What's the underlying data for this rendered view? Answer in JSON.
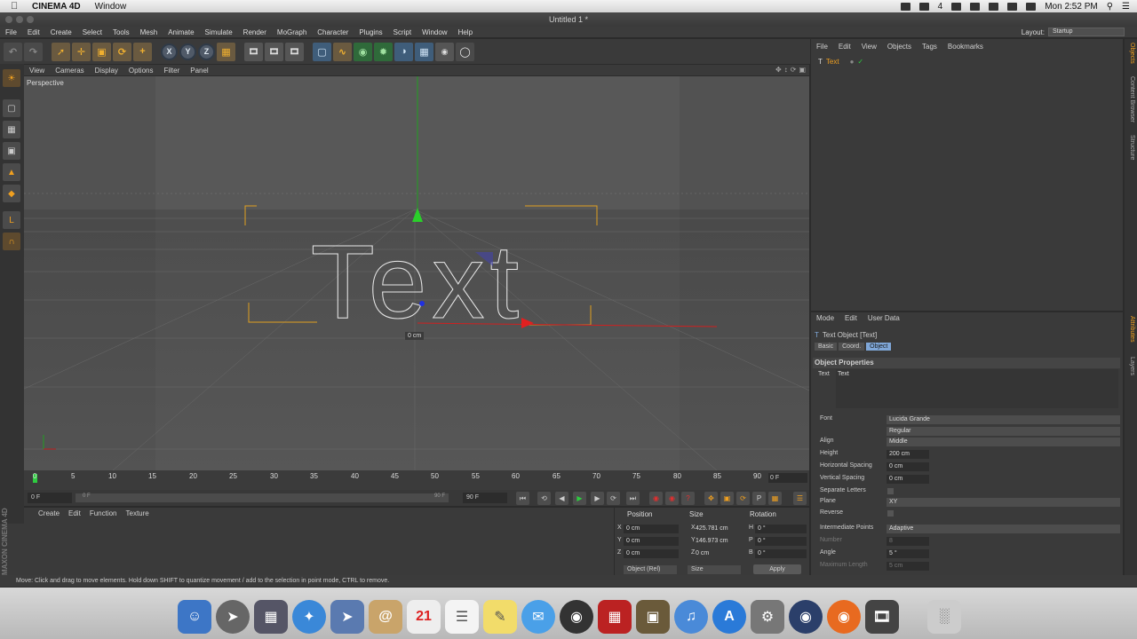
{
  "macbar": {
    "app_name": "CINEMA 4D",
    "menu": [
      "Window"
    ],
    "right_status": "4",
    "clock": "Mon 2:52 PM"
  },
  "window": {
    "title": "Untitled 1 *"
  },
  "app_menu": {
    "items": [
      "File",
      "Edit",
      "Create",
      "Select",
      "Tools",
      "Mesh",
      "Animate",
      "Simulate",
      "Render",
      "MoGraph",
      "Character",
      "Plugins",
      "Script",
      "Window",
      "Help"
    ],
    "layout_label": "Layout:",
    "layout_value": "Startup"
  },
  "viewport_menu": {
    "items": [
      "View",
      "Cameras",
      "Display",
      "Options",
      "Filter",
      "Panel"
    ]
  },
  "viewport": {
    "label": "Perspective",
    "readout": "0 cm",
    "text_object": "Text",
    "colors": {
      "bg": "#525252",
      "outline": "#e8e8e8",
      "x_axis": "#e02020",
      "y_axis": "#20d020",
      "z_axis": "#3030e0",
      "bbox": "#e0a020"
    }
  },
  "timeline": {
    "ticks": [
      "0",
      "5",
      "10",
      "15",
      "20",
      "25",
      "30",
      "35",
      "40",
      "45",
      "50",
      "55",
      "60",
      "65",
      "70",
      "75",
      "80",
      "85",
      "90"
    ],
    "frame_display": "0 F",
    "start_field": "0 F",
    "preview_start": "0 F",
    "preview_end": "90 F",
    "end_field": "90 F"
  },
  "material_menu": {
    "items": [
      "Create",
      "Edit",
      "Function",
      "Texture"
    ]
  },
  "brand_vertical": "MAXON CINEMA 4D",
  "coords": {
    "headers": {
      "position": "Position",
      "size": "Size",
      "rotation": "Rotation"
    },
    "rows": [
      {
        "axis": "X",
        "pos": "0 cm",
        "size_axis": "X",
        "size": "425.781 cm",
        "rot_axis": "H",
        "rot": "0 °"
      },
      {
        "axis": "Y",
        "pos": "0 cm",
        "size_axis": "Y",
        "size": "146.973 cm",
        "rot_axis": "P",
        "rot": "0 °"
      },
      {
        "axis": "Z",
        "pos": "0 cm",
        "size_axis": "Z",
        "size": "0 cm",
        "rot_axis": "B",
        "rot": "0 °"
      }
    ],
    "mode_dropdown": "Object (Rel)",
    "size_dropdown": "Size",
    "apply_label": "Apply"
  },
  "status_text": "Move: Click and drag to move elements. Hold down SHIFT to quantize movement / add to the selection in point mode, CTRL to remove.",
  "object_manager": {
    "menu": [
      "File",
      "Edit",
      "View",
      "Objects",
      "Tags",
      "Bookmarks"
    ],
    "objects": [
      {
        "name": "Text"
      }
    ]
  },
  "attributes": {
    "menu": [
      "Mode",
      "Edit",
      "User Data"
    ],
    "title": "Text Object [Text]",
    "tabs": [
      "Basic",
      "Coord.",
      "Object"
    ],
    "active_tab": "Object",
    "section": "Object Properties",
    "text_label": "Text",
    "text_value": "Text",
    "font_label": "Font",
    "font_value": "Lucida Grande",
    "font_style": "Regular",
    "align_label": "Align",
    "align_value": "Middle",
    "height_label": "Height",
    "height_value": "200 cm",
    "hspacing_label": "Horizontal Spacing",
    "hspacing_value": "0 cm",
    "vspacing_label": "Vertical Spacing",
    "vspacing_value": "0 cm",
    "separate_label": "Separate Letters",
    "plane_label": "Plane",
    "plane_value": "XY",
    "reverse_label": "Reverse",
    "interp_label": "Intermediate Points",
    "interp_value": "Adaptive",
    "number_label": "Number",
    "number_value": "8",
    "angle_label": "Angle",
    "angle_value": "5 °",
    "maxlen_label": "Maximum Length",
    "maxlen_value": "5 cm"
  },
  "right_tabs": [
    "Objects",
    "Content Browser",
    "Structure",
    "Attributes",
    "Layers"
  ]
}
